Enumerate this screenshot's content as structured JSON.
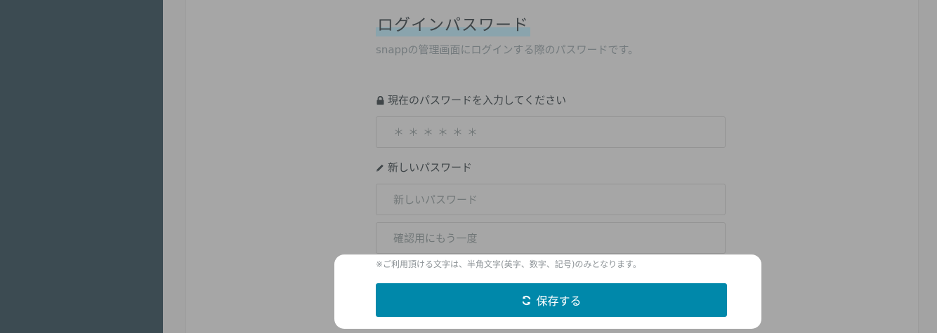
{
  "section": {
    "title": "ログインパスワード",
    "subtitle": "snappの管理画面にログインする際のパスワードです。"
  },
  "current_password": {
    "label": "現在のパスワードを入力してください",
    "placeholder": "＊＊＊＊＊＊",
    "icon": "lock-icon"
  },
  "new_password": {
    "label": "新しいパスワード",
    "placeholder": "新しいパスワード",
    "confirm_placeholder": "確認用にもう一度",
    "icon": "pencil-icon"
  },
  "note": "※ご利用頂ける文字は、半角文字(英字、数字、記号)のみとなります。",
  "save_button": {
    "label": "保存する",
    "icon": "refresh-icon",
    "color": "#0088aa"
  },
  "colors": {
    "sidebar": "#3c4b52",
    "overlay_background": "#a3a3a3",
    "highlight": "#ffffff"
  }
}
